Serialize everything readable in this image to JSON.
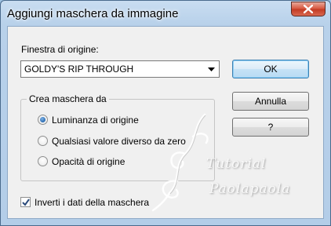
{
  "window": {
    "title": "Aggiungi maschera da immagine"
  },
  "source": {
    "label": "Finestra di origine:",
    "value": "GOLDY'S RIP THROUGH"
  },
  "buttons": {
    "ok": "OK",
    "cancel": "Annulla",
    "help": "?"
  },
  "group": {
    "legend": "Crea maschera da",
    "options": [
      {
        "label": "Luminanza di origine",
        "checked": true
      },
      {
        "label": "Qualsiasi valore diverso da zero",
        "checked": false
      },
      {
        "label": "Opacità di origine",
        "checked": false
      }
    ]
  },
  "invert": {
    "label": "Inverti i dati della maschera",
    "checked": true
  },
  "watermark": {
    "line1": "Tutorial",
    "line2": "Paolapaola"
  }
}
